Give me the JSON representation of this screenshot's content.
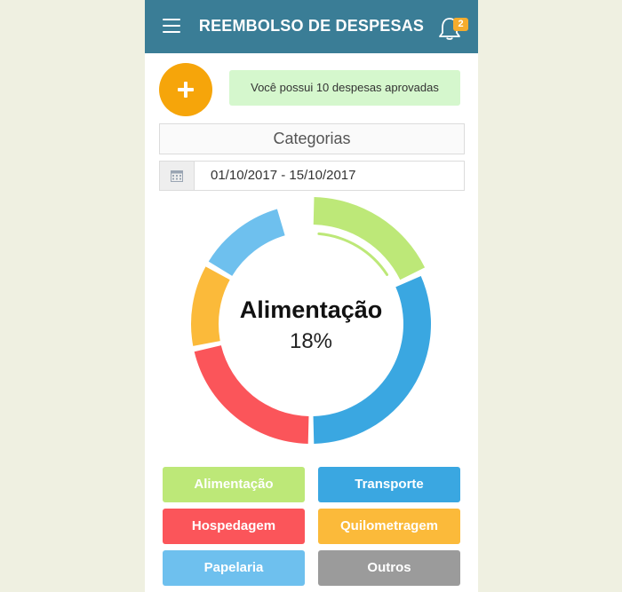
{
  "header": {
    "title": "REEMBOLSO DE DESPESAS",
    "notification_count": "2"
  },
  "approved_text": "Você possui 10 despesas aprovadas",
  "categories_title": "Categorias",
  "date_range": "01/10/2017 - 15/10/2017",
  "chart_data": {
    "type": "pie",
    "selected": {
      "label": "Alimentação",
      "percent": "18%"
    },
    "slices": [
      {
        "label": "Alimentação",
        "color": "#bde878",
        "start_deg": 0,
        "end_deg": 65
      },
      {
        "label": "Transporte",
        "color": "#3aa7e1",
        "start_deg": 65,
        "end_deg": 180
      },
      {
        "label": "Hospedagem",
        "color": "#fb555a",
        "start_deg": 180,
        "end_deg": 258
      },
      {
        "label": "Quilometragem",
        "color": "#fbba3a",
        "start_deg": 258,
        "end_deg": 300
      },
      {
        "label": "Papelaria",
        "color": "#6ec0ee",
        "start_deg": 300,
        "end_deg": 345
      }
    ]
  },
  "legend": [
    {
      "label": "Alimentação",
      "color": "#bde878"
    },
    {
      "label": "Transporte",
      "color": "#3aa7e1"
    },
    {
      "label": "Hospedagem",
      "color": "#fb555a"
    },
    {
      "label": "Quilometragem",
      "color": "#fbba3a"
    },
    {
      "label": "Papelaria",
      "color": "#6ec0ee"
    },
    {
      "label": "Outros",
      "color": "#9b9b9b"
    }
  ]
}
